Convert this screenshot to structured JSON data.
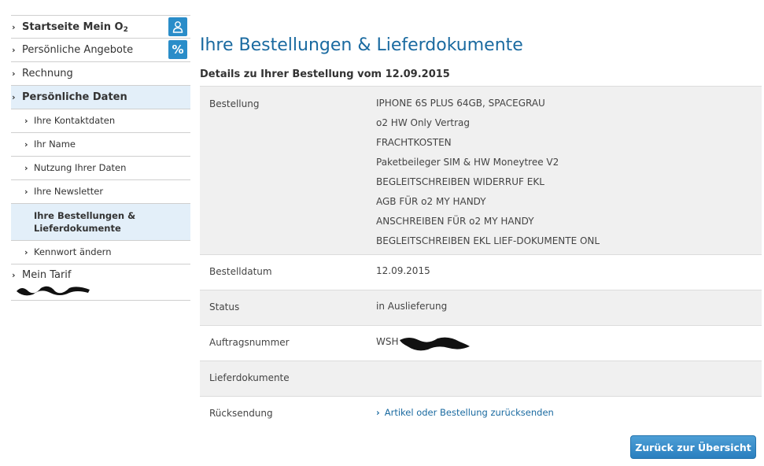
{
  "sidebar": {
    "items": [
      {
        "label": "Startseite Mein O",
        "sub": "2",
        "icon": "person-icon"
      },
      {
        "label": "Persönliche Angebote",
        "icon": "percent-icon",
        "icon_glyph": "%"
      },
      {
        "label": "Rechnung"
      },
      {
        "label": "Persönliche Daten"
      },
      {
        "label": "Ihre Kontaktdaten"
      },
      {
        "label": "Ihr Name"
      },
      {
        "label": "Nutzung Ihrer Daten"
      },
      {
        "label": "Ihre Newsletter"
      },
      {
        "label_line1": "Ihre Bestellungen &",
        "label_line2": "Lieferdokumente"
      },
      {
        "label": "Kennwort ändern"
      },
      {
        "label": "Mein Tarif"
      }
    ]
  },
  "main": {
    "title": "Ihre Bestellungen & Lieferdokumente",
    "order_heading": "Details zu Ihrer Bestellung vom 12.09.2015",
    "details": {
      "bestellung_label": "Bestellung",
      "items": [
        "IPHONE 6S PLUS 64GB, SPACEGRAU",
        "o2 HW Only Vertrag",
        "FRACHTKOSTEN",
        "Paketbeileger SIM & HW Moneytree V2",
        "BEGLEITSCHREIBEN WIDERRUF EKL",
        "AGB FÜR o2 MY HANDY",
        "ANSCHREIBEN FÜR o2 MY HANDY",
        "BEGLEITSCHREIBEN EKL LIEF-DOKUMENTE ONL"
      ],
      "bestelldatum_label": "Bestelldatum",
      "bestelldatum_value": "12.09.2015",
      "status_label": "Status",
      "status_value": "in Auslieferung",
      "auftragsnummer_label": "Auftragsnummer",
      "auftragsnummer_value": "WSH",
      "lieferdokumente_label": "Lieferdokumente",
      "ruecksendung_label": "Rücksendung",
      "ruecksendung_link": "Artikel oder Bestellung zurücksenden"
    },
    "back_button": "Zurück zur Übersicht"
  },
  "colors": {
    "accent": "#1a6aa0",
    "icon_bg": "#2a8dc9",
    "active_bg": "#e3eff9",
    "row_shade": "#f0f0f0"
  }
}
